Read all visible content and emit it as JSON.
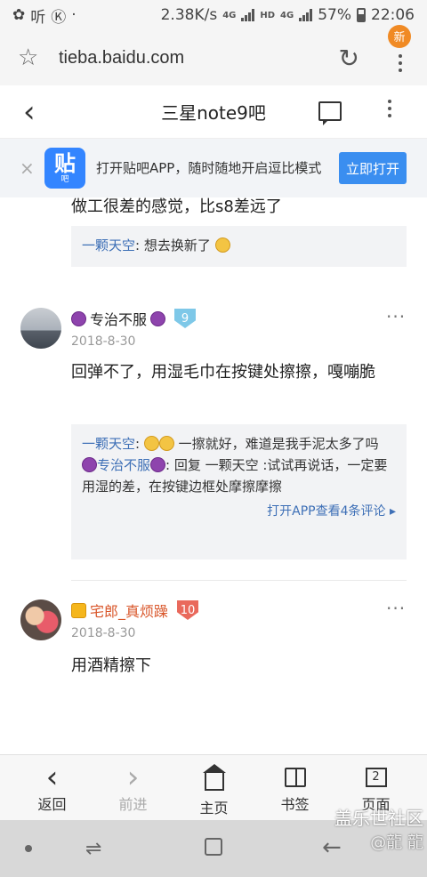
{
  "status_bar": {
    "left_app_icon": "✿",
    "left_icon_label": "听",
    "left_k_icon": "Ⓚ",
    "dot": "·",
    "speed": "2.38K/s",
    "net_4g": "4G",
    "hd": "HD",
    "net_4g_2": "4G",
    "battery": "57%",
    "time": "22:06"
  },
  "url_bar": {
    "url": "tieba.baidu.com",
    "new_badge": "新"
  },
  "header": {
    "back_glyph": "‹",
    "title": "三星note9吧"
  },
  "banner": {
    "close": "×",
    "logo_main": "贴",
    "logo_sub": "吧",
    "text": "打开贴吧APP，随时随地开启逗比模式",
    "button": "立即打开"
  },
  "top_fragment": {
    "text": "做工很差的感觉，比s8差远了",
    "reply_user": "一颗天空",
    "reply_text": ": 想去换新了"
  },
  "posts": [
    {
      "author": "专治不服",
      "level": "9",
      "date": "2018-8-30",
      "body": "回弹不了，用湿毛巾在按键处擦擦，嘎嘣脆",
      "replies": [
        {
          "user": "一颗天空",
          "text": " 一擦就好，难道是我手泥太多了吗"
        },
        {
          "user": "专治不服",
          "text": ": 回复 一颗天空 :试试再说话，一定要用湿的差，在按键边框处摩擦摩擦"
        }
      ],
      "view_more": "打开APP查看4条评论 ▸",
      "more_menu": "···"
    },
    {
      "author": "宅郎_真烦躁",
      "level": "10",
      "date": "2018-8-30",
      "body": "用酒精擦下",
      "more_menu": "···"
    }
  ],
  "bottom_nav": {
    "items": [
      {
        "glyph": "‹",
        "label": "返回"
      },
      {
        "glyph": "›",
        "label": "前进"
      },
      {
        "label": "主页"
      },
      {
        "label": "书签"
      },
      {
        "glyph": "2",
        "label": "页面"
      }
    ]
  },
  "watermark": {
    "line1": "盖乐世社区",
    "line2": "@龍 龍"
  },
  "system_nav": {
    "recent": "⇌",
    "back": "←"
  }
}
